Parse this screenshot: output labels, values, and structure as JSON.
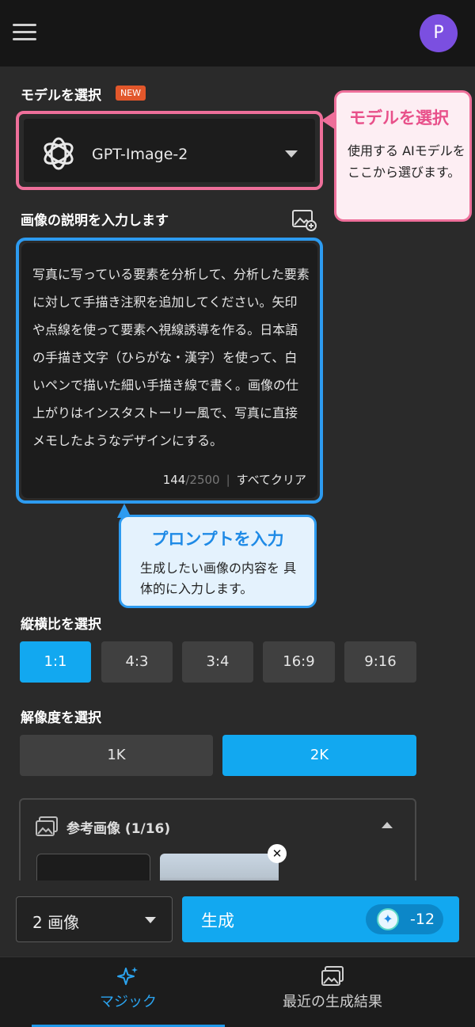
{
  "header": {
    "avatar_initial": "P"
  },
  "model_section": {
    "label": "モデルを選択",
    "badge": "NEW",
    "selected_model": "GPT-Image-2"
  },
  "callout_model": {
    "title": "モデルを選択",
    "body": "使用する AIモデルを ここから選びます。"
  },
  "prompt_section": {
    "label": "画像の説明を入力します",
    "text": "写真に写っている要素を分析して、分析した要素に対して手描き注釈を追加してください。矢印や点線を使って要素へ視線誘導を作る。日本語の手描き文字（ひらがな・漢字）を使って、白いペンで描いた細い手描き線で書く。画像の仕上がりはインスタストーリー風で、写真に直接メモしたようなデザインにする。",
    "char_count": "144",
    "char_max": "/2500",
    "separator": "|",
    "clear_label": "すべてクリア"
  },
  "callout_prompt": {
    "title": "プロンプトを入力",
    "body": "生成したい画像の内容を 具体的に入力します。"
  },
  "aspect_section": {
    "label": "縦横比を選択",
    "options": [
      "1:1",
      "4:3",
      "3:4",
      "16:9",
      "9:16"
    ],
    "selected": "1:1"
  },
  "resolution_section": {
    "label": "解像度を選択",
    "options": [
      "1K",
      "2K"
    ],
    "selected": "2K"
  },
  "reference_section": {
    "title": "参考画像 (1/16)",
    "close_glyph": "✕"
  },
  "action_bar": {
    "image_count": "2 画像",
    "generate_label": "生成",
    "credit_cost": "-12"
  },
  "tabs": [
    {
      "label": "マジック",
      "active": true
    },
    {
      "label": "最近の生成結果",
      "active": false
    }
  ],
  "colors": {
    "accent_blue": "#12a8f0",
    "callout_pink": "#ee6f9a",
    "callout_blue": "#2d9bf0",
    "avatar": "#7b4fe0"
  }
}
